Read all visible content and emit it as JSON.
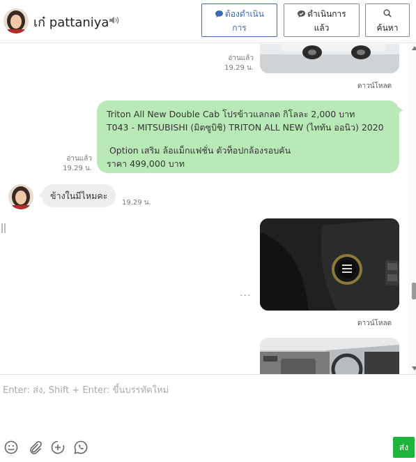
{
  "header": {
    "contact_name": "เก๋ pattaniya",
    "btn_todo": {
      "line1": "ต้องดำเนิน",
      "line2": "การ"
    },
    "btn_done": {
      "line1": "ดำเนินการ",
      "line2": "แล้ว"
    },
    "btn_search": {
      "label": "ค้นหา"
    }
  },
  "messages": {
    "top_image": {
      "read_status": "อ่านแล้ว",
      "time": "19.29 น.",
      "download": "ดาวน์โหลด"
    },
    "text_out": {
      "read_status": "อ่านแล้ว",
      "time": "19.29 น.",
      "lines": [
        "Triton All New Double Cab โปรข้าวแลกลด กิโลละ 2,000 บาท",
        "T043 - MITSUBISHI (มิตซูบิชิ) TRITON ALL NEW (ไททัน ออนิว) 2020",
        " Option เสริม ล้อแม็กแฟชั่น ตัวท็อปกล้องรอบคัน",
        "ราคา 499,000 บาท"
      ]
    },
    "text_in": {
      "text": "ข้างในมีไหมคะ",
      "time": "19.29 น."
    },
    "mid_image": {
      "download": "ดาวน์โหลด",
      "more": "···"
    }
  },
  "composer": {
    "placeholder": "Enter: ส่ง, Shift + Enter: ขึ้นบรรทัดใหม่",
    "value": "",
    "send_label": "ส่ง"
  },
  "icons": {
    "speaker": "speaker-icon",
    "todo": "chat-bubble-icon",
    "done": "chat-check-icon",
    "search": "search-icon",
    "emoji": "emoji-icon",
    "attach": "paperclip-icon",
    "add": "plus-circle-icon",
    "call": "phone-bubble-icon"
  },
  "colors": {
    "accent": "#3a6cb5",
    "outgoing_bubble": "#b9e9b6",
    "incoming_bubble": "#eeeeee",
    "send_button": "#1fb53c"
  }
}
